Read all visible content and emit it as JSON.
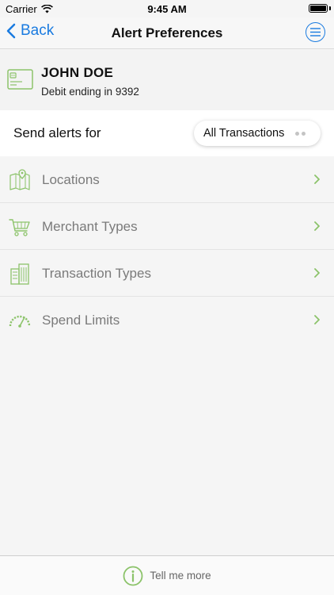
{
  "status_bar": {
    "carrier": "Carrier",
    "time": "9:45 AM",
    "wifi_icon": "wifi-icon",
    "battery_icon": "battery-icon"
  },
  "nav": {
    "back_label": "Back",
    "title": "Alert Preferences",
    "menu_icon": "hamburger-menu-icon"
  },
  "account": {
    "name": "JOHN DOE",
    "subtitle": "Debit ending in 9392",
    "icon": "credit-card-icon"
  },
  "alerts": {
    "label": "Send alerts for",
    "selected_value": "All Transactions"
  },
  "options": [
    {
      "label": "Locations",
      "icon": "map-pin-icon"
    },
    {
      "label": "Merchant Types",
      "icon": "shopping-cart-icon"
    },
    {
      "label": "Transaction Types",
      "icon": "building-icon"
    },
    {
      "label": "Spend Limits",
      "icon": "speedometer-icon"
    }
  ],
  "footer": {
    "label": "Tell me more",
    "icon": "info-icon"
  },
  "colors": {
    "accent_blue": "#1a7be0",
    "icon_green": "#8cc36a",
    "option_text": "#7a7a7a"
  }
}
